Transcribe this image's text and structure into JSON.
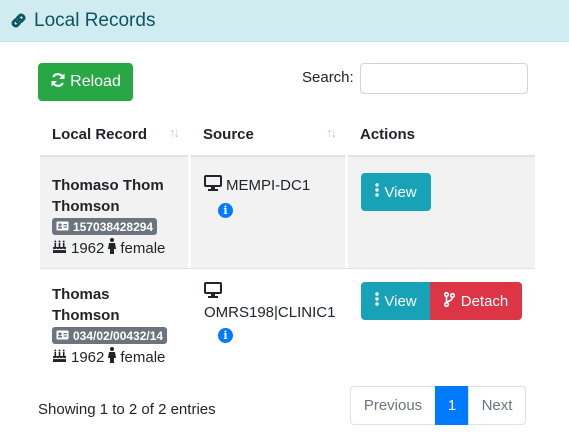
{
  "header": {
    "title": "Local Records",
    "icon": "link-icon"
  },
  "toolbar": {
    "reload_label": "Reload",
    "search_label": "Search:",
    "search_value": ""
  },
  "table": {
    "columns": [
      "Local Record",
      "Source",
      "Actions"
    ],
    "rows": [
      {
        "name_line1": "Thomaso Thom",
        "name_line2": "Thomson",
        "id": "157038428294",
        "year": "1962",
        "gender": "female",
        "source": "MEMPI-DC1",
        "actions": [
          "View"
        ]
      },
      {
        "name_line1": "Thomas",
        "name_line2": "Thomson",
        "id": "034/02/00432/14",
        "year": "1962",
        "gender": "female",
        "source": "OMRS198|CLINIC1",
        "actions": [
          "View",
          "Detach"
        ]
      }
    ]
  },
  "footer": {
    "info": "Showing 1 to 2 of 2 entries",
    "previous": "Previous",
    "current_page": "1",
    "next": "Next"
  },
  "colors": {
    "header_bg": "#d1ecf1",
    "header_text": "#0c5460",
    "reload": "#28a745",
    "view": "#17a2b8",
    "detach": "#dc3545",
    "page_active": "#007bff",
    "badge": "#6c757d",
    "info": "#007bff"
  }
}
